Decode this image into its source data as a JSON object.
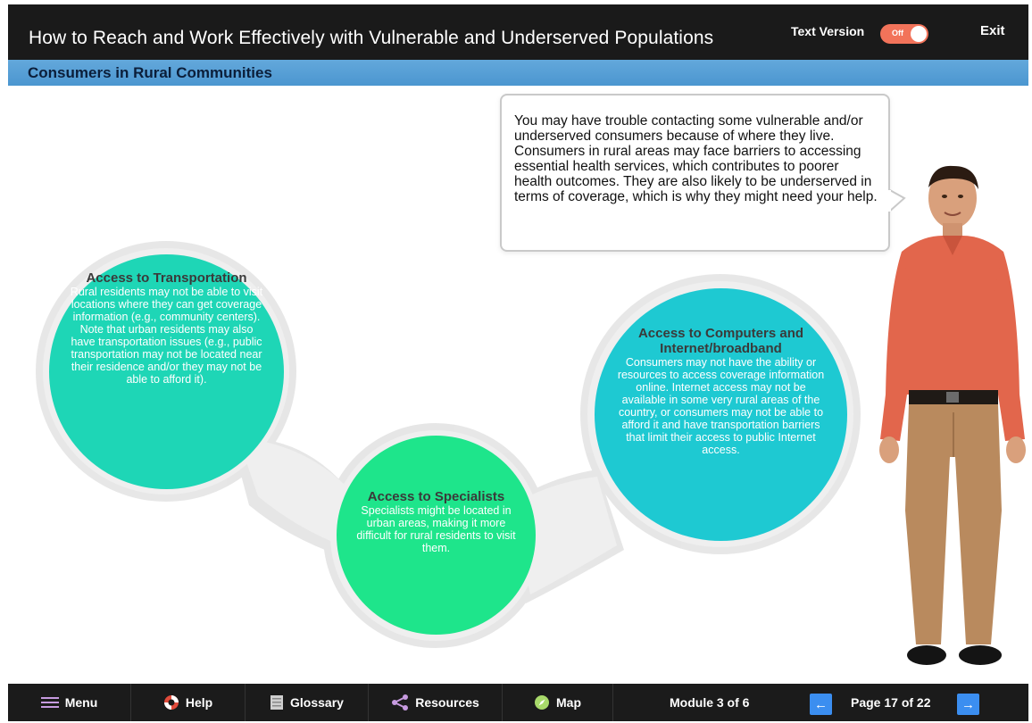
{
  "header": {
    "course_title": "How to Reach and Work Effectively with Vulnerable and Underserved Populations",
    "text_version_label": "Text Version",
    "toggle_state": "Off",
    "exit_label": "Exit"
  },
  "section": {
    "title": "Consumers in Rural Communities"
  },
  "speech": {
    "text": "You may have trouble contacting some vulnerable and/or underserved consumers because of where they live. Consumers in rural areas may face barriers to accessing essential health services, which contributes to poorer health outcomes. They are also likely to be underserved in terms of coverage, which is why they might need your help."
  },
  "bubbles": [
    {
      "title": "Access to Transportation",
      "body": "Rural residents may not be able to visit locations where they can get coverage information (e.g., community centers). Note that urban residents may also have transportation issues (e.g., public transportation may not be located near their residence and/or they may not be able to afford it)."
    },
    {
      "title": "Access to Specialists",
      "body": "Specialists might be located in urban areas, making it more difficult for rural residents to visit them."
    },
    {
      "title": "Access to Computers and Internet/broadband",
      "body": "Consumers may not have the ability or resources to access coverage information online. Internet access may not be available in some very rural areas of the country, or consumers may not be able to afford it and have transportation barriers that limit their access to public Internet access."
    }
  ],
  "nav": {
    "menu": "Menu",
    "help": "Help",
    "glossary": "Glossary",
    "resources": "Resources",
    "map": "Map",
    "module": "Module 3 of 6",
    "prev": "←",
    "page": "Page 17 of 22",
    "next": "→"
  },
  "colors": {
    "transport_bubble": "#1ed6b6",
    "specialists_bubble": "#1ee58b",
    "computers_bubble": "#1ec9d2",
    "section_bar": "#4b96d0",
    "toggle": "#f2735a",
    "nav_arrow": "#3b8ef0"
  }
}
